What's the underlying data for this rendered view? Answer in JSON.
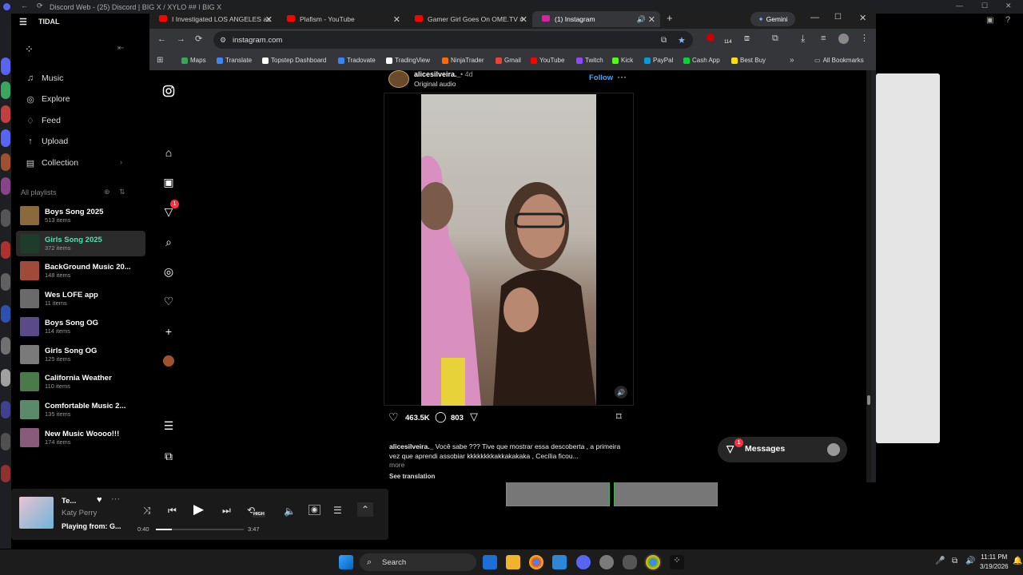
{
  "discord": {
    "title": "Discord Web - (25) Discord | BIG X / XYLO ## | BIG X"
  },
  "tidal": {
    "app_title": "TIDAL",
    "nav": [
      {
        "label": "Music",
        "icon": "music-note-icon"
      },
      {
        "label": "Explore",
        "icon": "globe-icon"
      },
      {
        "label": "Feed",
        "icon": "bell-icon"
      },
      {
        "label": "Upload",
        "icon": "upload-icon"
      },
      {
        "label": "Collection",
        "icon": "collection-icon"
      }
    ],
    "playlists_header": "All playlists",
    "playlists": [
      {
        "name": "Boys Song 2025",
        "count": "513 items",
        "color": "#8a6a3a",
        "active": false
      },
      {
        "name": "Girls Song 2025",
        "count": "372 items",
        "color": "#1f3b2b",
        "active": true
      },
      {
        "name": "BackGround Music 20...",
        "count": "148 items",
        "color": "#a04a3a",
        "active": false
      },
      {
        "name": "Wes LOFE app",
        "count": "11 items",
        "color": "#6a6a6a",
        "active": false
      },
      {
        "name": "Boys Song OG",
        "count": "114 items",
        "color": "#5a4a8a",
        "active": false
      },
      {
        "name": "Girls Song OG",
        "count": "125 items",
        "color": "#7a7a7a",
        "active": false
      },
      {
        "name": "California Weather",
        "count": "110 items",
        "color": "#4a7a4a",
        "active": false
      },
      {
        "name": "Comfortable Music 2...",
        "count": "135 items",
        "color": "#5a8a6a",
        "active": false
      },
      {
        "name": "New Music Woooo!!!",
        "count": "174 items",
        "color": "#8a5a7a",
        "active": false
      }
    ],
    "player": {
      "track": "Te...",
      "artist": "Katy Perry",
      "playing_from": "Playing from: G...",
      "elapsed": "0:40",
      "duration": "3:47",
      "progress": 0.18,
      "quality": "HIGH"
    }
  },
  "browser": {
    "tabs": [
      {
        "label": "I Investigated LOS ANGELES as",
        "fav": "#ff0000"
      },
      {
        "label": "Plafism - YouTube",
        "fav": "#ff0000"
      },
      {
        "label": "Gamer Girl Goes On OME.TV #",
        "fav": "#ff0000"
      },
      {
        "label": "(1) Instagram",
        "fav": "#d6249f"
      }
    ],
    "gemini": "Gemini",
    "url": "instagram.com",
    "bookmarks": [
      {
        "label": "Maps",
        "color": "#34a853"
      },
      {
        "label": "Translate",
        "color": "#4285f4"
      },
      {
        "label": "Topstep Dashboard",
        "color": "#ffffff"
      },
      {
        "label": "Tradovate",
        "color": "#3b82f6"
      },
      {
        "label": "TradingView",
        "color": "#ffffff"
      },
      {
        "label": "NinjaTrader",
        "color": "#ff6b00"
      },
      {
        "label": "Gmail",
        "color": "#ea4335"
      },
      {
        "label": "YouTube",
        "color": "#ff0000"
      },
      {
        "label": "Twitch",
        "color": "#9146ff"
      },
      {
        "label": "Kick",
        "color": "#53fc18"
      },
      {
        "label": "PayPal",
        "color": "#009cde"
      },
      {
        "label": "Cash App",
        "color": "#00d632"
      },
      {
        "label": "Best Buy",
        "color": "#ffe000"
      }
    ],
    "all_bookmarks": "All Bookmarks",
    "ext_badge": "114"
  },
  "instagram": {
    "notifications_badge": "1",
    "post": {
      "username": "alicesilveira._",
      "age": "• 4d",
      "audio": "Original audio",
      "follow": "Follow",
      "likes": "463.5K",
      "comments": "803",
      "caption_user": "alicesilveira._",
      "caption": "Você sabe ??? Tive que mostrar essa descoberta , a primeira vez que aprendi assobiar kkkkkkkkakkakakaka , Cecília ficou...",
      "more": "more",
      "see_translation": "See translation"
    },
    "messages": {
      "label": "Messages",
      "badge": "1"
    }
  },
  "taskbar": {
    "search": "Search",
    "time": "11:11 PM",
    "date": "3/19/2026"
  }
}
